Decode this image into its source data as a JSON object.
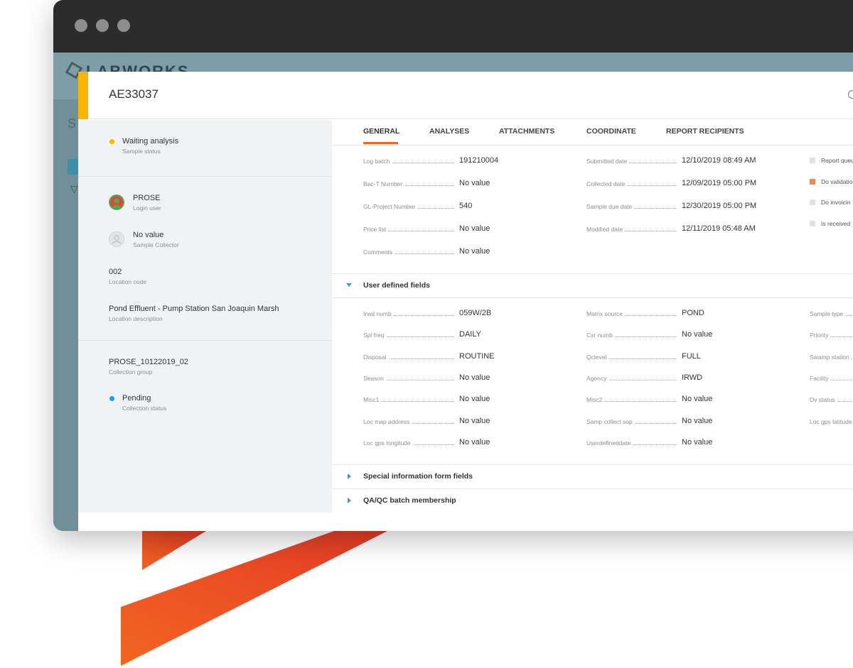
{
  "app": {
    "brand": "LABWORKS",
    "bg_search_hint": "S"
  },
  "modal": {
    "sample_id": "AE33037"
  },
  "sidebar": {
    "sample_status": {
      "value": "Waiting analysis",
      "label": "Sample status",
      "dot_color": "#f7b500"
    },
    "login_user": {
      "value": "PROSE",
      "label": "Login user"
    },
    "sample_collector": {
      "value": "No value",
      "label": "Sample Collector"
    },
    "location_code": {
      "value": "002",
      "label": "Location code"
    },
    "location_description": {
      "value": "Pond Effluent - Pump Station San Joaquin Marsh",
      "label": "Location description"
    },
    "collection_group": {
      "value": "PROSE_10122019_02",
      "label": "Collection group"
    },
    "collection_status": {
      "value": "Pending",
      "label": "Collection status",
      "dot_color": "#1e9bef"
    }
  },
  "tabs": [
    "GENERAL",
    "ANALYSES",
    "ATTACHMENTS",
    "COORDINATE",
    "REPORT RECIPIENTS"
  ],
  "general": {
    "col1": [
      {
        "label": "Log batch",
        "value": "191210004"
      },
      {
        "label": "Bac-T Number",
        "value": "No value"
      },
      {
        "label": "GL-Project Number",
        "value": "540"
      },
      {
        "label": "Price list",
        "value": "No value"
      },
      {
        "label": "Comments",
        "value": "No value"
      }
    ],
    "col2": [
      {
        "label": "Submitted date",
        "value": "12/10/2019 08:49 AM"
      },
      {
        "label": "Collected date",
        "value": "12/09/2019 05:00 PM"
      },
      {
        "label": "Sample due date",
        "value": "12/30/2019 05:00 PM"
      },
      {
        "label": "Modified date",
        "value": "12/11/2019 05:48 AM"
      }
    ],
    "checks": [
      {
        "label": "Report queu",
        "checked": false
      },
      {
        "label": "Do validatio",
        "checked": true
      },
      {
        "label": "Do invoicin",
        "checked": false
      },
      {
        "label": "Is received",
        "checked": false
      }
    ]
  },
  "sections": {
    "user_defined": "User defined fields",
    "special_info": "Special information form fields",
    "qaqc": "QA/QC batch membership"
  },
  "user_defined": {
    "col1": [
      {
        "label": "Irwd numb",
        "value": "059W/2B"
      },
      {
        "label": "Spl freq",
        "value": "DAILY"
      },
      {
        "label": "Disposal",
        "value": "ROUTINE"
      },
      {
        "label": "Season",
        "value": "No value"
      },
      {
        "label": "Misc1",
        "value": "No value"
      },
      {
        "label": "Loc map address",
        "value": "No value"
      },
      {
        "label": "Loc gps longitude",
        "value": "No value"
      }
    ],
    "col2": [
      {
        "label": "Matrix source",
        "value": "POND"
      },
      {
        "label": "Csr numb",
        "value": "No value"
      },
      {
        "label": "Qclevel",
        "value": "FULL"
      },
      {
        "label": "Agency",
        "value": "IRWD"
      },
      {
        "label": "Misc2",
        "value": "No value"
      },
      {
        "label": "Samp collect sop",
        "value": "No value"
      },
      {
        "label": "Userdefineddate",
        "value": "No value"
      }
    ],
    "col3": [
      {
        "label": "Sample type"
      },
      {
        "label": "Priority"
      },
      {
        "label": "Swamp station"
      },
      {
        "label": "Facility"
      },
      {
        "label": "Dv status"
      },
      {
        "label": "Loc gps latitude"
      }
    ]
  },
  "colors": {
    "accent": "#f26522",
    "status_yellow": "#f7b500",
    "checked": "#f08a5d"
  }
}
